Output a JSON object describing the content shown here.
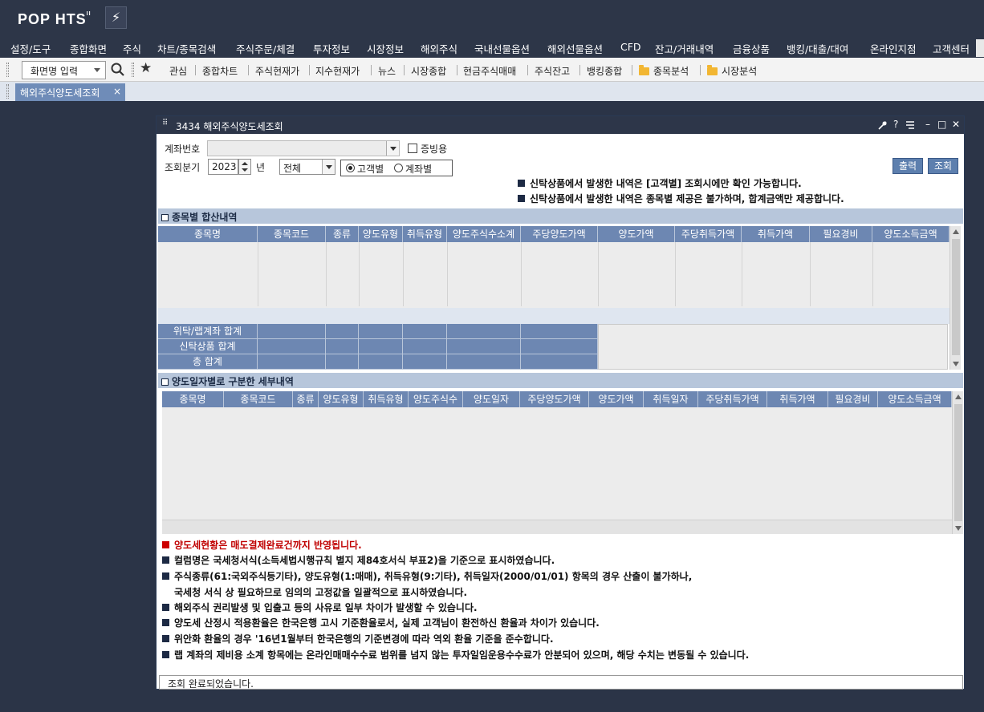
{
  "app": {
    "logo": "POP HTS",
    "logo_sup": "II",
    "bolt_glyph": "⚡"
  },
  "menu": [
    "설정/도구",
    "종합화면",
    "주식",
    "차트/종목검색",
    "주식주문/체결",
    "투자정보",
    "시장정보",
    "해외주식",
    "국내선물옵션",
    "해외선물옵션",
    "CFD",
    "잔고/거래내역",
    "금융상품",
    "뱅킹/대출/대여",
    "온라인지점",
    "고객센터"
  ],
  "toolbar": {
    "screen_input": "화면명 입력",
    "links": [
      "관심",
      "종합차트",
      "주식현재가",
      "지수현재가",
      "뉴스",
      "시장종합",
      "현금주식매매",
      "주식잔고",
      "뱅킹종합"
    ],
    "folders": [
      "종목분석",
      "시장분석"
    ]
  },
  "tab": {
    "label": "해외주식양도세조회",
    "close": "×"
  },
  "window": {
    "title": "3434 해외주식양도세조회",
    "controls": [
      "?",
      "–",
      "□",
      "✕"
    ]
  },
  "form": {
    "account_label": "계좌번호",
    "account_value": "",
    "proof_label": "증빙용",
    "period_label": "조회분기",
    "year_value": "2023",
    "year_unit": "년",
    "quarter_value": "전체",
    "radio_customer": "고객별",
    "radio_account": "계좌별",
    "print_button": "출력",
    "search_button": "조회"
  },
  "notes": [
    "신탁상품에서 발생한 내역은 [고객별] 조회시에만 확인 가능합니다.",
    "신탁상품에서 발생한 내역은 종목별 제공은 불가하며, 합계금액만 제공합니다."
  ],
  "section1": {
    "title": "종목별 합산내역",
    "columns": [
      "종목명",
      "종목코드",
      "종류",
      "양도유형",
      "취득유형",
      "양도주식수소계",
      "주당양도가액",
      "양도가액",
      "주당취득가액",
      "취득가액",
      "필요경비",
      "양도소득금액"
    ],
    "summary_rows": [
      "위탁/랩계좌 합계",
      "신탁상품 합계",
      "총 합계"
    ]
  },
  "section2": {
    "title": "양도일자별로 구분한 세부내역",
    "columns": [
      "종목명",
      "종목코드",
      "종류",
      "양도유형",
      "취득유형",
      "양도주식수",
      "양도일자",
      "주당양도가액",
      "양도가액",
      "취득일자",
      "주당취득가액",
      "취득가액",
      "필요경비",
      "양도소득금액"
    ]
  },
  "info_lines": [
    "양도세현황은 매도결제완료건까지 반영됩니다.",
    "컬럼명은 국세청서식(소득세법시행규칙 별지 제84호서식 부표2)을 기준으로 표시하였습니다.",
    "주식종류(61:국외주식등기타), 양도유형(1:매매), 취득유형(9:기타), 취득일자(2000/01/01) 항목의 경우 산출이 불가하나,",
    "국세청 서식 상 필요하므로 임의의 고정값을 일괄적으로 표시하였습니다.",
    "해외주식 권리발생 및 입출고 등의 사유로 일부 차이가 발생할 수 있습니다.",
    "양도세 산정시 적용환율은 한국은행 고시 기준환율로서, 실제 고객님이 환전하신 환율과 차이가 있습니다.",
    "위안화 환율의 경우 '16년1월부터 한국은행의 기준변경에 따라 역외 환율 기준을 준수합니다.",
    "랩 계좌의 제비용 소계 항목에는 온라인매매수수료 범위를 넘지 않는 투자일임운용수수료가 안분되어 있으며, 해당 수치는 변동될 수 있습니다."
  ],
  "status": "조회 완료되었습니다."
}
